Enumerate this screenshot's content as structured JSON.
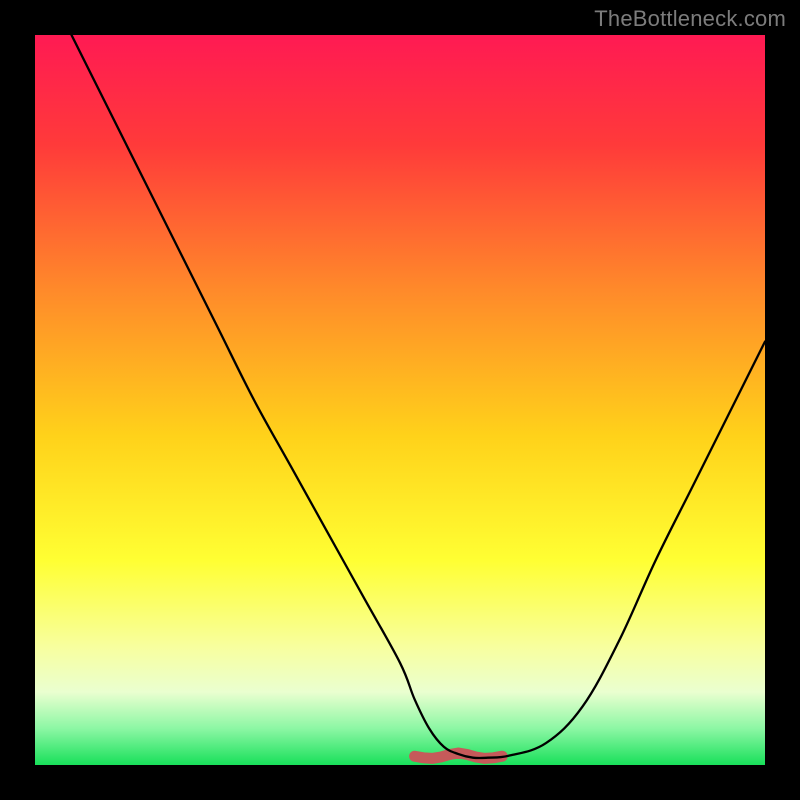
{
  "watermark": "TheBottleneck.com",
  "colors": {
    "frame": "#000000",
    "gradient_stops": [
      {
        "offset": 0.0,
        "color": "#ff1a53"
      },
      {
        "offset": 0.15,
        "color": "#ff3a3a"
      },
      {
        "offset": 0.35,
        "color": "#ff8a2a"
      },
      {
        "offset": 0.55,
        "color": "#ffd21a"
      },
      {
        "offset": 0.72,
        "color": "#ffff33"
      },
      {
        "offset": 0.84,
        "color": "#f7ffa0"
      },
      {
        "offset": 0.9,
        "color": "#eaffd0"
      },
      {
        "offset": 0.95,
        "color": "#8cf7a4"
      },
      {
        "offset": 1.0,
        "color": "#18e05a"
      }
    ],
    "curve": "#000000",
    "near_bottom_segment": "#c65a5a"
  },
  "chart_data": {
    "type": "line",
    "title": "",
    "xlabel": "",
    "ylabel": "",
    "xlim": [
      0,
      100
    ],
    "ylim": [
      0,
      100
    ],
    "series": [
      {
        "name": "bottleneck-curve",
        "x": [
          5,
          10,
          15,
          20,
          25,
          30,
          35,
          40,
          45,
          50,
          52,
          54,
          56,
          58,
          60,
          62,
          65,
          70,
          75,
          80,
          85,
          90,
          95,
          100
        ],
        "y": [
          100,
          90,
          80,
          70,
          60,
          50,
          41,
          32,
          23,
          14,
          9,
          5,
          2.5,
          1.5,
          1,
          1,
          1.3,
          3,
          8,
          17,
          28,
          38,
          48,
          58
        ]
      }
    ],
    "annotations": [
      {
        "name": "near-bottom-band",
        "x_start": 52,
        "x_end": 64,
        "y": 1.2,
        "note": "thick-red-segment"
      }
    ]
  }
}
